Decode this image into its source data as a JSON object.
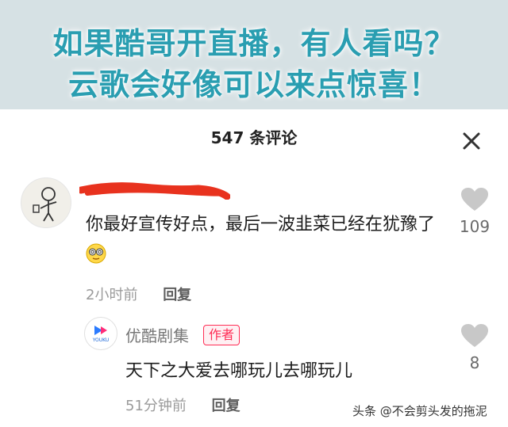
{
  "banner": {
    "line1": "如果酷哥开直播，有人看吗？",
    "line2": "云歌会好像可以来点惊喜！"
  },
  "comments_panel": {
    "title": "547 条评论"
  },
  "comment": {
    "text": "你最好宣传好点，最后一波韭菜已经在犹豫了",
    "time": "2小时前",
    "reply_label": "回复",
    "likes": "109"
  },
  "reply": {
    "author": "优酷剧集",
    "badge": "作者",
    "avatar_text": "YOUKU",
    "text": "天下之大爱去哪玩儿去哪玩儿",
    "time": "51分钟前",
    "reply_label": "回复",
    "likes": "8"
  },
  "watermark": "头条 @不会剪头发的拖泥",
  "colors": {
    "banner_text": "#2a9eb1",
    "badge": "#ff2d55",
    "redaction": "#e8321e"
  }
}
